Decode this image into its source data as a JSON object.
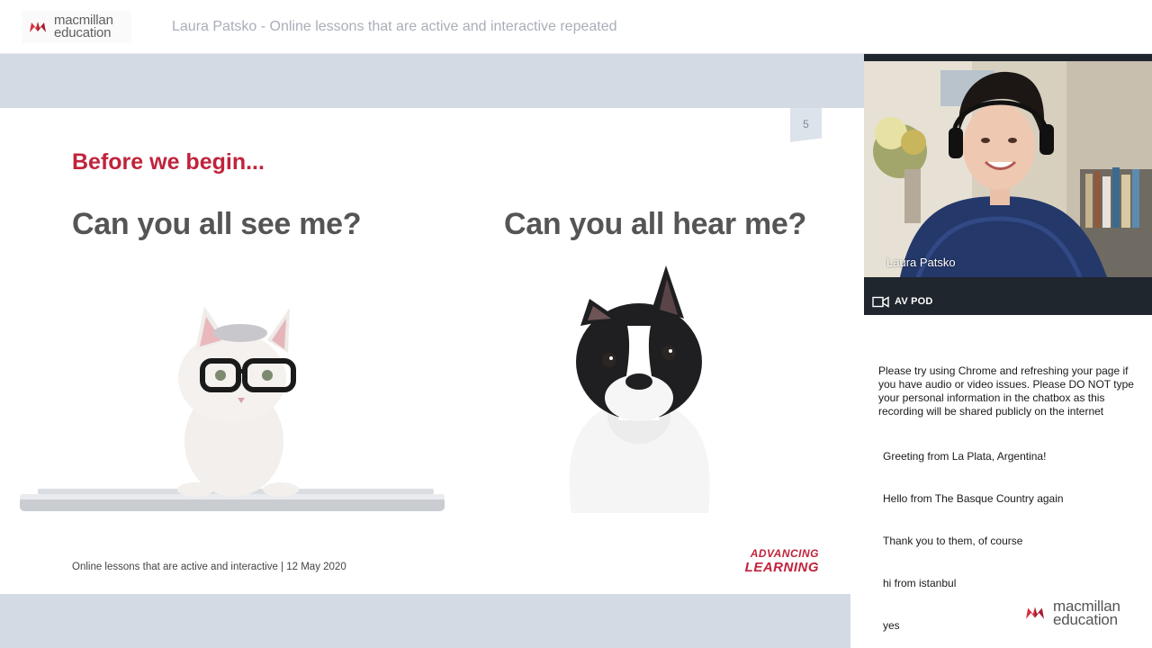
{
  "header": {
    "logo": {
      "line1": "macmillan",
      "line2": "education"
    },
    "session_title": "Laura Patsko - Online lessons that are active and interactive repeated"
  },
  "slide": {
    "page_number": "5",
    "kicker": "Before we begin...",
    "question_left": "Can you all see me?",
    "question_right": "Can you all hear me?",
    "footer": "Online lessons that are active and interactive | 12 May 2020",
    "brand_line1": "ADVANCING",
    "brand_line2": "LEARNING"
  },
  "av_pod": {
    "presenter_name": "Laura Patsko",
    "label": "AV POD"
  },
  "chat": {
    "notice": "Please try using Chrome and refreshing your page if you have audio or video issues. Please DO NOT type your personal information in the chatbox as this recording will be shared publicly on the internet",
    "messages": [
      "Greeting from La Plata, Argentina!",
      "Hello from The Basque Country again",
      "Thank you to them, of course",
      "hi from istanbul",
      "yes"
    ]
  },
  "footer_logo": {
    "line1": "macmillan",
    "line2": "education"
  },
  "colors": {
    "brand_red": "#c0233b",
    "stage_band": "#d4dae4",
    "pod_dark": "#20262e"
  }
}
